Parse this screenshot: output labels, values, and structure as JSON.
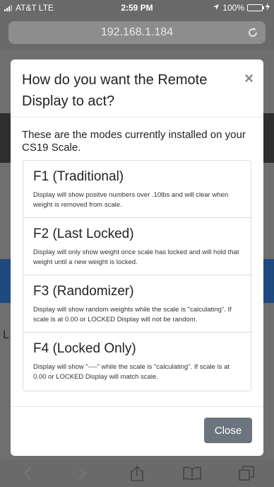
{
  "status_bar": {
    "carrier": "AT&T",
    "network": "LTE",
    "time": "2:59 PM",
    "battery_text": "100%"
  },
  "browser": {
    "url": "192.168.1.184"
  },
  "modal": {
    "title": "How do you want the Remote Display to act?",
    "intro": "These are the modes currently installed on your CS19 Scale.",
    "modes": [
      {
        "title": "F1 (Traditional)",
        "description": "Display will show positve numbers over .10lbs and will clear when weight is removed from scale."
      },
      {
        "title": "F2 (Last Locked)",
        "description": "Display will only show weight once scale has locked and will hold that weight until a new weight is locked."
      },
      {
        "title": "F3 (Randomizer)",
        "description": "Display will show random weights while the scale is \"calculating\". If scale is at 0.00 or LOCKED Display will not be random."
      },
      {
        "title": "F4 (Locked Only)",
        "description": "Display will show \"----\" while the scale is \"calculating\". If scale is at 0.00 or LOCKED Display will match scale."
      }
    ],
    "close_label": "Close"
  },
  "background_page": {
    "edge_text": "L"
  },
  "colors": {
    "overlay": "#6a6a6a",
    "close_button": "#6c757d",
    "battery": "#4cd964",
    "dark_stripe": "#2e2e2e",
    "blue_stripe": "#1f4a80"
  }
}
